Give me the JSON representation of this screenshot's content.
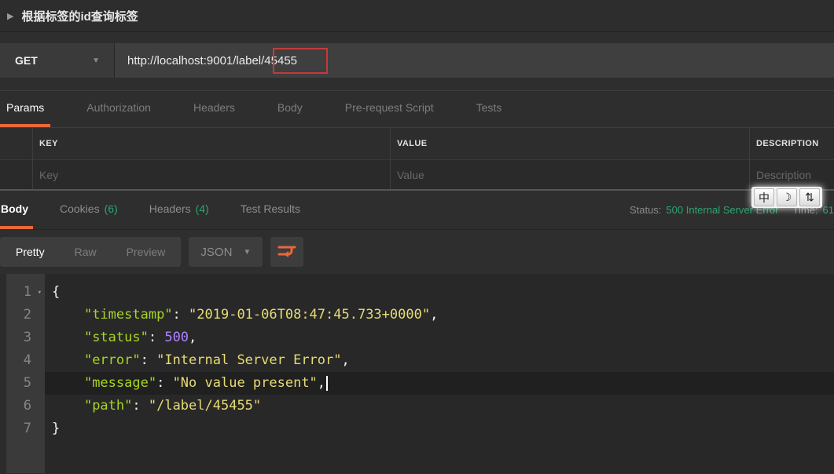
{
  "window": {
    "title": "根据标签的id查询标签"
  },
  "request": {
    "method": "GET",
    "url_prefix": "http://localhost:9001/label/",
    "url_highlight": "45455"
  },
  "request_tabs": {
    "items": [
      {
        "label": "Params"
      },
      {
        "label": "Authorization"
      },
      {
        "label": "Headers"
      },
      {
        "label": "Body"
      },
      {
        "label": "Pre-request Script"
      },
      {
        "label": "Tests"
      }
    ]
  },
  "params_table": {
    "headers": {
      "key": "KEY",
      "value": "VALUE",
      "description": "DESCRIPTION"
    },
    "row": {
      "key": "Key",
      "value": "Value",
      "description": "Description"
    }
  },
  "response": {
    "tabs": [
      {
        "label": "Body",
        "count": ""
      },
      {
        "label": "Cookies",
        "count": "(6)"
      },
      {
        "label": "Headers",
        "count": "(4)"
      },
      {
        "label": "Test Results",
        "count": ""
      }
    ],
    "status_label": "Status:",
    "status_value": "500 Internal Server Error",
    "time_label": "Time:",
    "time_value": "61"
  },
  "ime_toolbar": {
    "chinese_mode": "中",
    "halfwidth_moon": "☽",
    "width_toggle": "⇅"
  },
  "viewer": {
    "modes": [
      {
        "label": "Pretty"
      },
      {
        "label": "Raw"
      },
      {
        "label": "Preview"
      }
    ],
    "format": "JSON"
  },
  "colors": {
    "accent_orange": "#e8683a",
    "status_green": "#2ea56f",
    "annotation_red": "#c23b3b",
    "json_key": "#a6d426",
    "json_string": "#e6db74",
    "json_number": "#ae81ff"
  },
  "editor": {
    "lines": [
      {
        "num": "1",
        "fold": true,
        "tokens": [
          [
            "punc",
            "{"
          ]
        ]
      },
      {
        "num": "2",
        "tokens": [
          [
            "punc",
            "    "
          ],
          [
            "key",
            "\"timestamp\""
          ],
          [
            "punc",
            ": "
          ],
          [
            "str",
            "\"2019-01-06T08:47:45.733+0000\""
          ],
          [
            "punc",
            ","
          ]
        ]
      },
      {
        "num": "3",
        "tokens": [
          [
            "punc",
            "    "
          ],
          [
            "key",
            "\"status\""
          ],
          [
            "punc",
            ": "
          ],
          [
            "num",
            "500"
          ],
          [
            "punc",
            ","
          ]
        ]
      },
      {
        "num": "4",
        "tokens": [
          [
            "punc",
            "    "
          ],
          [
            "key",
            "\"error\""
          ],
          [
            "punc",
            ": "
          ],
          [
            "str",
            "\"Internal Server Error\""
          ],
          [
            "punc",
            ","
          ]
        ]
      },
      {
        "num": "5",
        "current": true,
        "cursor": true,
        "tokens": [
          [
            "punc",
            "    "
          ],
          [
            "key",
            "\"message\""
          ],
          [
            "punc",
            ": "
          ],
          [
            "str",
            "\"No value present\""
          ],
          [
            "punc",
            ","
          ]
        ]
      },
      {
        "num": "6",
        "tokens": [
          [
            "punc",
            "    "
          ],
          [
            "key",
            "\"path\""
          ],
          [
            "punc",
            ": "
          ],
          [
            "str",
            "\"/label/45455\""
          ]
        ]
      },
      {
        "num": "7",
        "tokens": [
          [
            "punc",
            "}"
          ]
        ]
      }
    ]
  }
}
